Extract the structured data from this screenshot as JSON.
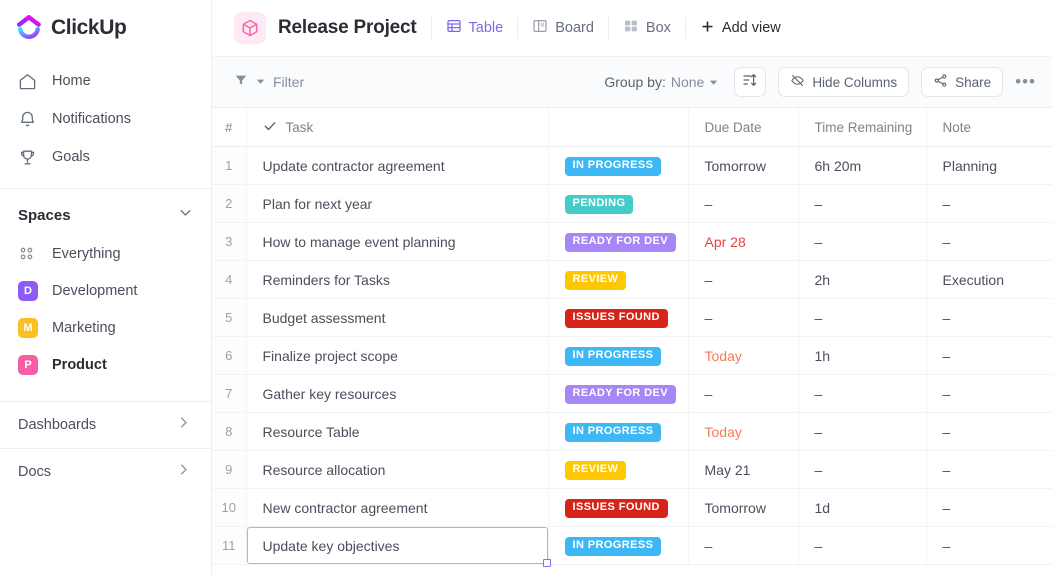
{
  "brand": {
    "name": "ClickUp",
    "accent": "#7b68ee",
    "logo_icon": "clickup-logo-icon"
  },
  "sidebar": {
    "nav": [
      {
        "label": "Home",
        "icon": "home-icon"
      },
      {
        "label": "Notifications",
        "icon": "bell-icon"
      },
      {
        "label": "Goals",
        "icon": "trophy-icon"
      }
    ],
    "spaces_title": "Spaces",
    "spaces": [
      {
        "label": "Everything",
        "icon": "grid-dots-icon",
        "initial": "",
        "color": ""
      },
      {
        "label": "Development",
        "icon": "space-avatar",
        "initial": "D",
        "color": "#8b5cf6"
      },
      {
        "label": "Marketing",
        "icon": "space-avatar",
        "initial": "M",
        "color": "#fbbf24"
      },
      {
        "label": "Product",
        "icon": "space-avatar",
        "initial": "P",
        "color": "#f75ea5",
        "active": true
      }
    ],
    "footer": [
      {
        "label": "Dashboards",
        "icon": "chevron-right-icon"
      },
      {
        "label": "Docs",
        "icon": "chevron-right-icon"
      }
    ]
  },
  "header": {
    "project_icon": "cube-icon",
    "project_title": "Release Project",
    "views": [
      {
        "label": "Table",
        "icon": "table-icon",
        "active": true
      },
      {
        "label": "Board",
        "icon": "board-icon",
        "active": false
      },
      {
        "label": "Box",
        "icon": "box-icon",
        "active": false
      }
    ],
    "add_view": "Add view",
    "add_view_icon": "plus-icon"
  },
  "toolbar": {
    "filter_label": "Filter",
    "filter_icon": "funnel-icon",
    "group_by_label": "Group by:",
    "group_by_value": "None",
    "sort_icon": "sort-icon",
    "hide_columns_label": "Hide Columns",
    "hide_columns_icon": "eye-off-icon",
    "share_label": "Share",
    "share_icon": "share-icon",
    "more_icon": "more-horizontal-icon",
    "more_label": "•••"
  },
  "table": {
    "columns": {
      "num": "#",
      "task": "Task",
      "task_icon": "check-icon",
      "status": "",
      "due": "Due Date",
      "time": "Time Remaining",
      "note": "Note"
    },
    "empty_value": "–",
    "status_colors": {
      "IN PROGRESS": "#3db8f5",
      "PENDING": "#43ccc8",
      "READY FOR DEV": "#a687f5",
      "REVIEW": "#ffc700",
      "ISSUES FOUND": "#d62518"
    },
    "rows": [
      {
        "num": "1",
        "task": "Update contractor agreement",
        "status": "IN PROGRESS",
        "due": "Tomorrow",
        "due_style": "",
        "time": "6h 20m",
        "note": "Planning"
      },
      {
        "num": "2",
        "task": "Plan for next year",
        "status": "PENDING",
        "due": "–",
        "due_style": "",
        "time": "–",
        "note": "–"
      },
      {
        "num": "3",
        "task": "How to manage event planning",
        "status": "READY FOR DEV",
        "due": "Apr 28",
        "due_style": "red",
        "time": "–",
        "note": "–"
      },
      {
        "num": "4",
        "task": "Reminders for Tasks",
        "status": "REVIEW",
        "due": "–",
        "due_style": "",
        "time": "2h",
        "note": "Execution"
      },
      {
        "num": "5",
        "task": "Budget assessment",
        "status": "ISSUES FOUND",
        "due": "–",
        "due_style": "",
        "time": "–",
        "note": "–"
      },
      {
        "num": "6",
        "task": "Finalize project scope",
        "status": "IN PROGRESS",
        "due": "Today",
        "due_style": "orange",
        "time": "1h",
        "note": "–"
      },
      {
        "num": "7",
        "task": "Gather key resources",
        "status": "READY FOR DEV",
        "due": "–",
        "due_style": "",
        "time": "–",
        "note": "–"
      },
      {
        "num": "8",
        "task": "Resource Table",
        "status": "IN PROGRESS",
        "due": "Today",
        "due_style": "orange",
        "time": "–",
        "note": "–"
      },
      {
        "num": "9",
        "task": "Resource allocation",
        "status": "REVIEW",
        "due": "May 21",
        "due_style": "",
        "time": "–",
        "note": "–"
      },
      {
        "num": "10",
        "task": "New contractor agreement",
        "status": "ISSUES FOUND",
        "due": "Tomorrow",
        "due_style": "",
        "time": "1d",
        "note": "–"
      },
      {
        "num": "11",
        "task": "Update key objectives",
        "status": "IN PROGRESS",
        "due": "–",
        "due_style": "",
        "time": "–",
        "note": "–",
        "focused": true
      }
    ]
  }
}
